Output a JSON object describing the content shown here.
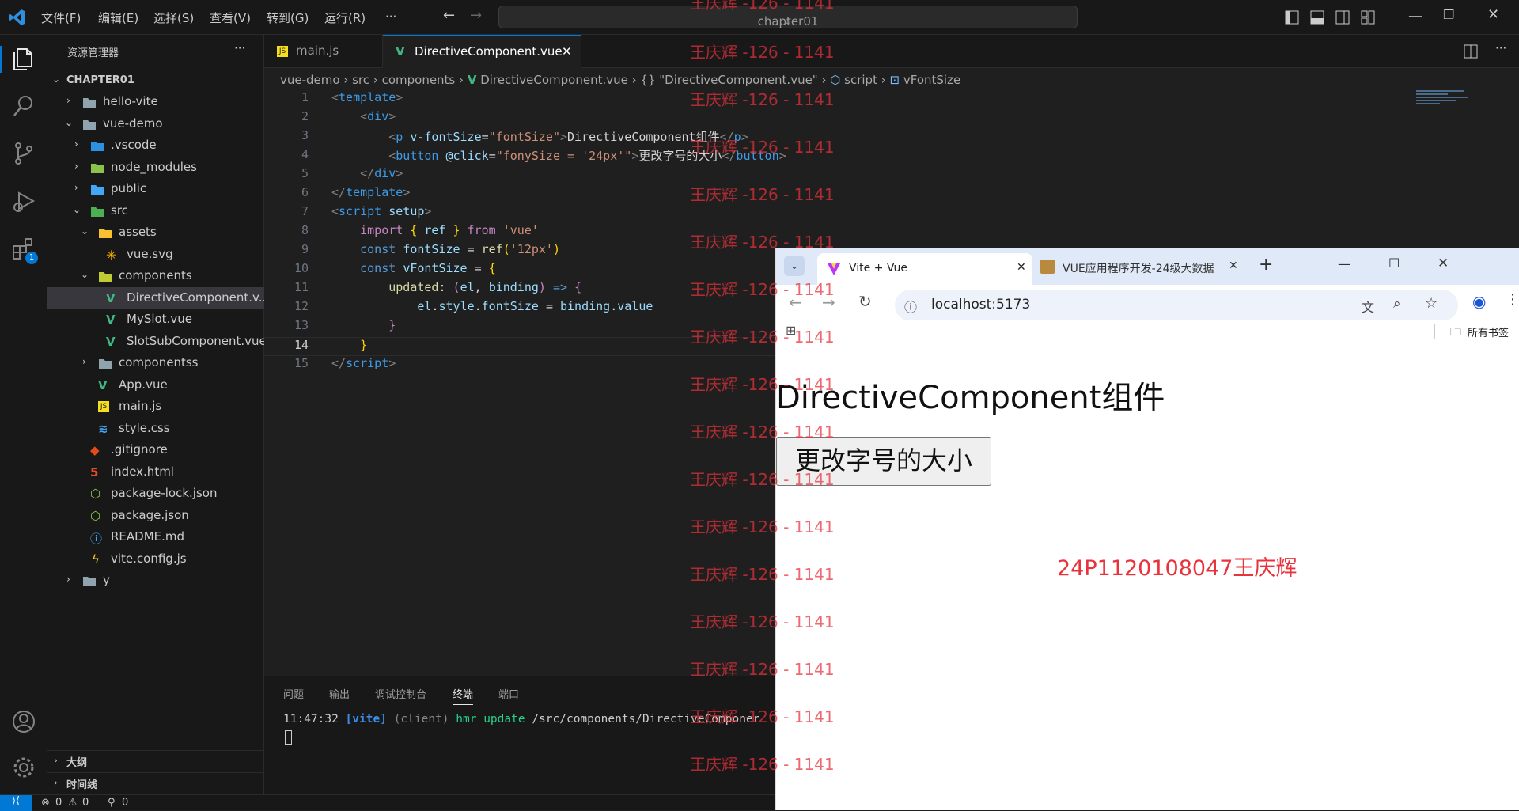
{
  "titlebar": {
    "menus": [
      "文件(F)",
      "编辑(E)",
      "选择(S)",
      "查看(V)",
      "转到(G)",
      "运行(R)",
      "···"
    ],
    "search": "chapter01"
  },
  "sidebar": {
    "title": "资源管理器",
    "more": "···",
    "root": "CHAPTER01",
    "items": [
      "hello-vite",
      "vue-demo",
      ".vscode",
      "node_modules",
      "public",
      "src",
      "assets",
      "vue.svg",
      "components",
      "DirectiveComponent.v...",
      "MySlot.vue",
      "SlotSubComponent.vue",
      "componentss",
      "App.vue",
      "main.js",
      "style.css",
      ".gitignore",
      "index.html",
      "package-lock.json",
      "package.json",
      "README.md",
      "vite.config.js",
      "y"
    ],
    "outline": "大纲",
    "timeline": "时间线"
  },
  "activity_badge": "1",
  "tabs": [
    "main.js",
    "DirectiveComponent.vue"
  ],
  "breadcrumb": [
    "vue-demo",
    "src",
    "components",
    "DirectiveComponent.vue",
    "{} \"DirectiveComponent.vue\"",
    "script",
    "vFontSize"
  ],
  "code_lines": [
    "1",
    "2",
    "3",
    "4",
    "5",
    "6",
    "7",
    "8",
    "9",
    "10",
    "11",
    "12",
    "13",
    "14",
    "15"
  ],
  "panel": {
    "tabs": [
      "问题",
      "输出",
      "调试控制台",
      "终端",
      "端口"
    ],
    "time": "11:47:32",
    "tag": "[vite]",
    "client": "(client)",
    "msg": "hmr update",
    "path": "/src/components/DirectiveComponer"
  },
  "status": {
    "errors": "0",
    "warnings": "0",
    "ports": "0"
  },
  "browser": {
    "tab1": "Vite + Vue",
    "tab2": "VUE应用程序开发-24级大数据",
    "url": "localhost:5173",
    "bookmarks": "所有书签",
    "heading": "DirectiveComponent组件",
    "button": "更改字号的大小",
    "student": "24P1120108047王庆辉"
  },
  "watermark": "王庆辉 -126 - 1141",
  "colors": {
    "accent": "#0078d4",
    "vue": "#41b883",
    "watermark": "#e8323c"
  }
}
